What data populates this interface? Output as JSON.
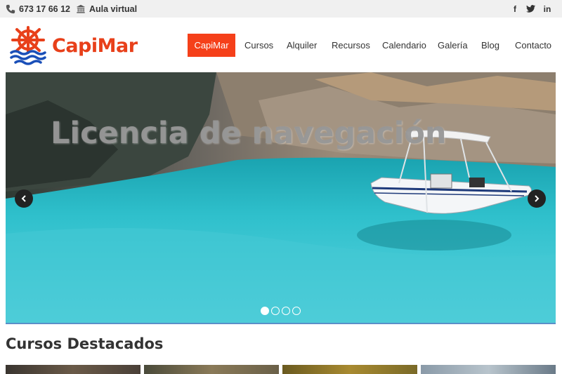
{
  "topbar": {
    "phone": "673 17 66 12",
    "phone_icon": "phone-icon",
    "aula": "Aula virtual",
    "aula_icon": "institution-icon",
    "social": [
      {
        "name": "facebook",
        "glyph": "f"
      },
      {
        "name": "twitter",
        "glyph": "t"
      },
      {
        "name": "linkedin",
        "glyph": "in"
      }
    ]
  },
  "header": {
    "logo_text": "CapiMar",
    "nav": [
      "CapiMar",
      "Cursos",
      "Alquiler",
      "Recursos",
      "Calendario",
      "Galería",
      "Blog",
      "Contacto"
    ],
    "active_nav": "CapiMar"
  },
  "hero": {
    "title": "Licencia de navegación",
    "prev_glyph": "‹",
    "next_glyph": "›",
    "slides": 4,
    "active_slide": 1
  },
  "section": {
    "title": "Cursos Destacados"
  },
  "colors": {
    "accent": "#f5401a",
    "logo_red": "#e8401a",
    "logo_blue": "#1a4fb8",
    "topbar_bg": "#f0f0f0",
    "water": "#2fb7c4"
  }
}
